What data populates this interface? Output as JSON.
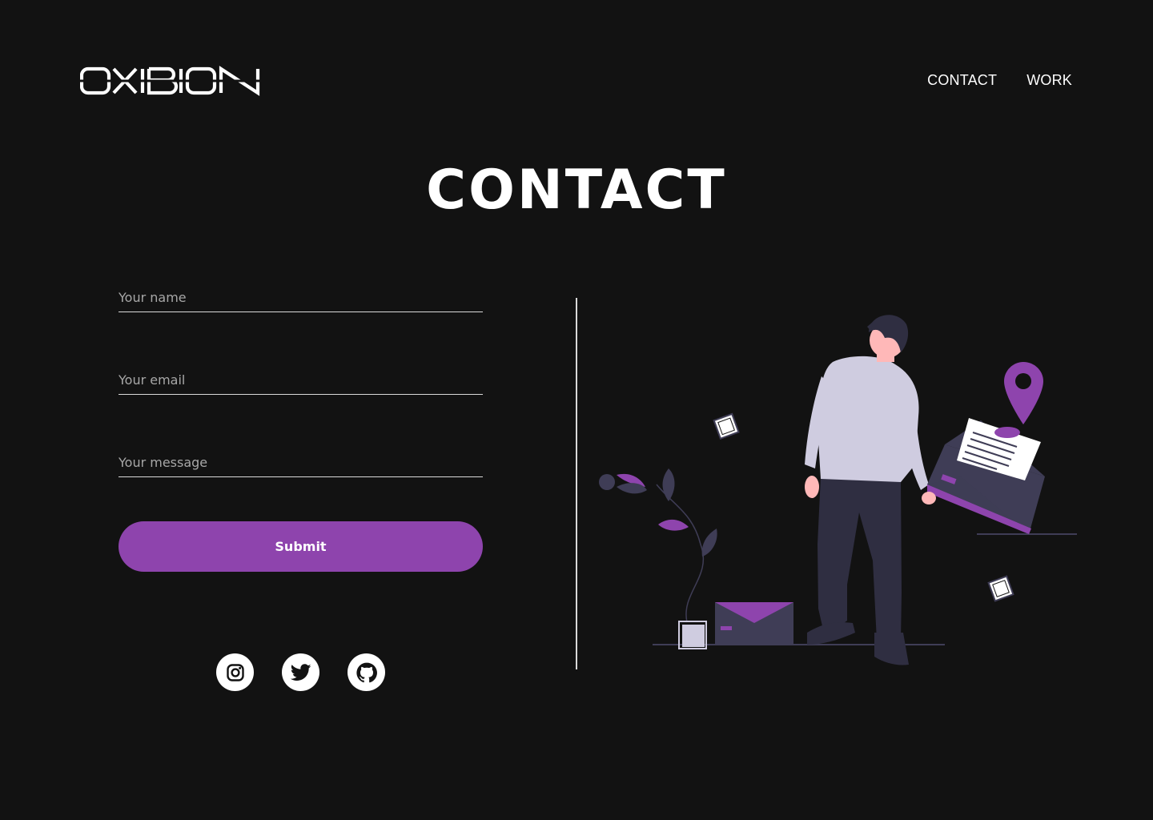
{
  "brand": {
    "logo_text": "OXIBION"
  },
  "nav": {
    "items": [
      {
        "label": "CONTACT"
      },
      {
        "label": "WORK"
      }
    ]
  },
  "page": {
    "title": "CONTACT"
  },
  "form": {
    "name_placeholder": "Your name",
    "email_placeholder": "Your email",
    "message_placeholder": "Your message",
    "submit_label": "Submit"
  },
  "socials": [
    {
      "icon": "instagram-icon"
    },
    {
      "icon": "twitter-icon"
    },
    {
      "icon": "github-icon"
    }
  ],
  "colors": {
    "background": "#121212",
    "accent": "#8e44ad",
    "text": "#ffffff",
    "placeholder": "#a7a7a7"
  }
}
